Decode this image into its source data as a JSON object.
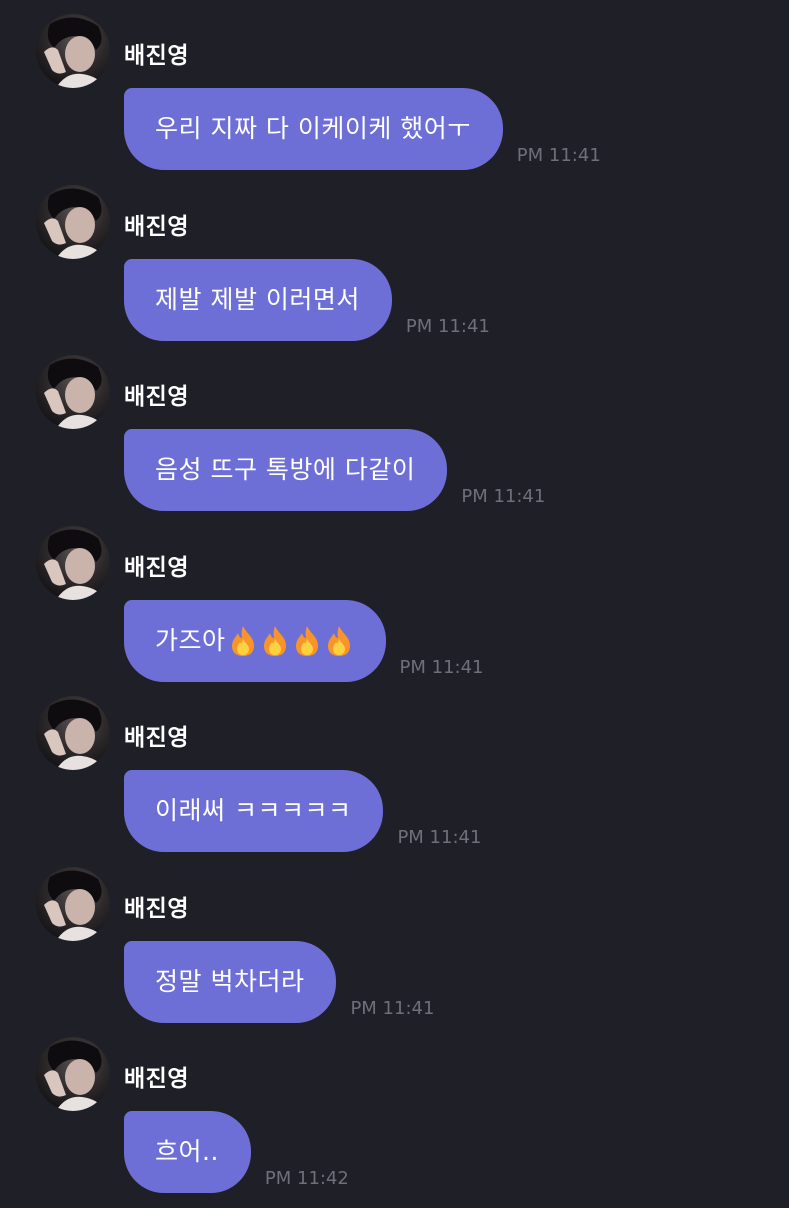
{
  "colors": {
    "background": "#1f1f27",
    "bubble": "#6e6fd6",
    "timestamp": "#6f6f7a"
  },
  "messages": [
    {
      "sender": "배진영",
      "text": "우리 지짜 다 이케이케 했어ㅜ",
      "time": "PM 11:41"
    },
    {
      "sender": "배진영",
      "text": "제발 제발 이러면서",
      "time": "PM 11:41"
    },
    {
      "sender": "배진영",
      "text": "음성 뜨구 톡방에 다같이",
      "time": "PM 11:41"
    },
    {
      "sender": "배진영",
      "text": "가즈아",
      "emoji": "fire-icon",
      "emoji_count": 4,
      "time": "PM 11:41"
    },
    {
      "sender": "배진영",
      "text": "이래써 ㅋㅋㅋㅋㅋ",
      "time": "PM 11:41"
    },
    {
      "sender": "배진영",
      "text": "정말 벅차더라",
      "time": "PM 11:41"
    },
    {
      "sender": "배진영",
      "text": "흐어..",
      "time": "PM 11:42"
    }
  ]
}
